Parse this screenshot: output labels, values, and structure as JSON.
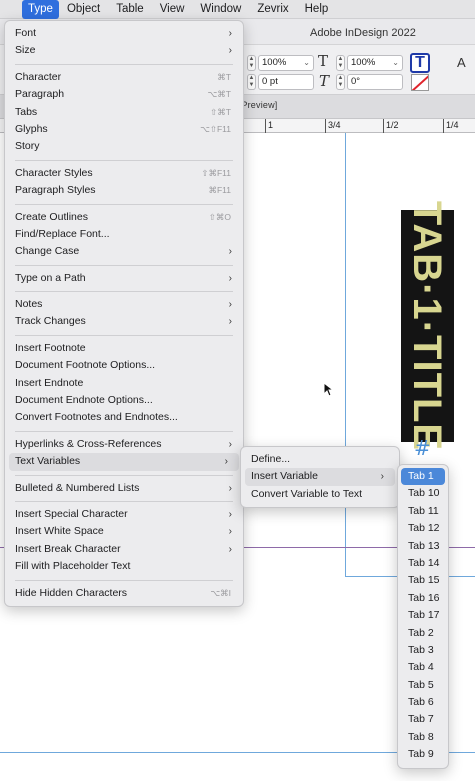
{
  "menubar": {
    "items": [
      "Type",
      "Object",
      "Table",
      "View",
      "Window",
      "Zevrix",
      "Help"
    ],
    "active": "Type"
  },
  "app": {
    "title": "Adobe InDesign 2022",
    "document_tab": "U Preview]"
  },
  "controlbar": {
    "scale_x": "100%",
    "scale_y": "100%",
    "tracking": "0 pt",
    "skew": "0°"
  },
  "ruler": {
    "labels": [
      "1",
      "3/4",
      "1/2",
      "1/4"
    ]
  },
  "canvas": {
    "tab_label": "TAB·1·TITLE",
    "marker": "#"
  },
  "type_menu": {
    "items": [
      {
        "label": "Font",
        "submenu": true
      },
      {
        "label": "Size",
        "submenu": true
      },
      {
        "sep": true
      },
      {
        "label": "Character",
        "shortcut": "⌘T"
      },
      {
        "label": "Paragraph",
        "shortcut": "⌥⌘T"
      },
      {
        "label": "Tabs",
        "shortcut": "⇧⌘T"
      },
      {
        "label": "Glyphs",
        "shortcut": "⌥⇧F11"
      },
      {
        "label": "Story"
      },
      {
        "sep": true
      },
      {
        "label": "Character Styles",
        "shortcut": "⇧⌘F11"
      },
      {
        "label": "Paragraph Styles",
        "shortcut": "⌘F11"
      },
      {
        "sep": true
      },
      {
        "label": "Create Outlines",
        "shortcut": "⇧⌘O"
      },
      {
        "label": "Find/Replace Font..."
      },
      {
        "label": "Change Case",
        "submenu": true
      },
      {
        "sep": true
      },
      {
        "label": "Type on a Path",
        "submenu": true
      },
      {
        "sep": true
      },
      {
        "label": "Notes",
        "submenu": true
      },
      {
        "label": "Track Changes",
        "submenu": true
      },
      {
        "sep": true
      },
      {
        "label": "Insert Footnote"
      },
      {
        "label": "Document Footnote Options..."
      },
      {
        "label": "Insert Endnote"
      },
      {
        "label": "Document Endnote Options..."
      },
      {
        "label": "Convert Footnotes and Endnotes..."
      },
      {
        "sep": true
      },
      {
        "label": "Hyperlinks & Cross-References",
        "submenu": true
      },
      {
        "label": "Text Variables",
        "submenu": true,
        "highlighted": true
      },
      {
        "sep": true
      },
      {
        "label": "Bulleted & Numbered Lists",
        "submenu": true
      },
      {
        "sep": true
      },
      {
        "label": "Insert Special Character",
        "submenu": true
      },
      {
        "label": "Insert White Space",
        "submenu": true
      },
      {
        "label": "Insert Break Character",
        "submenu": true
      },
      {
        "label": "Fill with Placeholder Text"
      },
      {
        "sep": true
      },
      {
        "label": "Hide Hidden Characters",
        "shortcut": "⌥⌘I"
      }
    ]
  },
  "text_variables_menu": {
    "items": [
      {
        "label": "Define..."
      },
      {
        "label": "Insert Variable",
        "submenu": true,
        "highlighted": true
      },
      {
        "label": "Convert Variable to Text"
      }
    ]
  },
  "insert_variable_menu": {
    "items": [
      "Tab 1",
      "Tab 10",
      "Tab 11",
      "Tab 12",
      "Tab 13",
      "Tab 14",
      "Tab 15",
      "Tab 16",
      "Tab 17",
      "Tab 2",
      "Tab 3",
      "Tab 4",
      "Tab 5",
      "Tab 6",
      "Tab 7",
      "Tab 8",
      "Tab 9"
    ],
    "selected": "Tab 1"
  },
  "colors": {
    "menu_selection": "#4b88d9",
    "menubar_active": "#2f6fde",
    "tab_label_bg": "#141414",
    "tab_label_text": "#d8d690",
    "guide": "#6fa8dc"
  }
}
